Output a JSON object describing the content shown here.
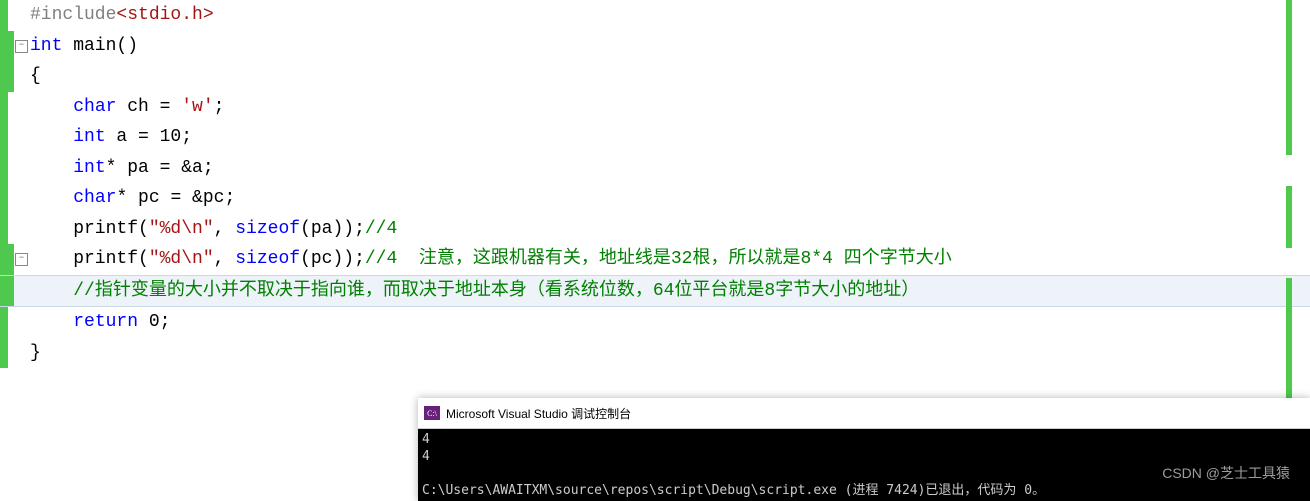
{
  "code": {
    "l1_pre": "#include",
    "l1_file": "<stdio.h>",
    "l2_kw": "int",
    "l2_main": " main()",
    "l3": "{",
    "l4_pre": "    ",
    "l4_type": "char",
    "l4_rest": " ch = ",
    "l4_str": "'w'",
    "l4_end": ";",
    "l5_pre": "    ",
    "l5_type": "int",
    "l5_rest": " a = 10;",
    "l6": "",
    "l7_pre": "    ",
    "l7_type": "int",
    "l7_rest": "* pa = &a;",
    "l8_pre": "    ",
    "l8_type": "char",
    "l8_rest": "* pc = &pc;",
    "l9": "",
    "l10_pre": "    printf(",
    "l10_str": "\"%d\\n\"",
    "l10_mid": ", ",
    "l10_sizeof": "sizeof",
    "l10_arg": "(pa));",
    "l10_comment": "//4",
    "l11_pre": "    printf(",
    "l11_str": "\"%d\\n\"",
    "l11_mid": ", ",
    "l11_sizeof": "sizeof",
    "l11_arg": "(pc));",
    "l11_comment": "//4  注意，这跟机器有关，地址线是32根，所以就是8*4 四个字节大小",
    "l12_pre": "    ",
    "l12_comment": "//指针变量的大小并不取决于指向谁，而取决于地址本身（看系统位数，64位平台就是8字节大小的地址）",
    "l13_pre": "    ",
    "l13_kw": "return",
    "l13_rest": " 0;",
    "l14": "}"
  },
  "console": {
    "title": "Microsoft Visual Studio 调试控制台",
    "icon_text": "C:\\",
    "out1": "4",
    "out2": "4",
    "out3": "",
    "out4": "C:\\Users\\AWAITXM\\source\\repos\\script\\Debug\\script.exe (进程 7424)已退出，代码为 0。"
  },
  "watermark": "CSDN @芝士工具猿"
}
